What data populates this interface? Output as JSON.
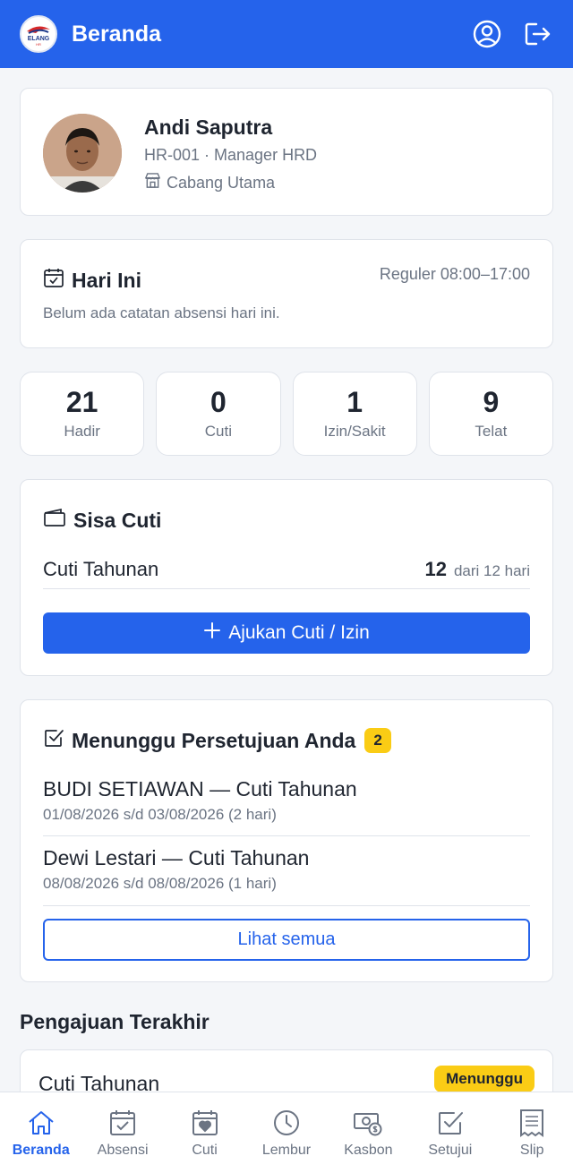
{
  "header": {
    "title": "Beranda",
    "logo_text": "ELANG",
    "logo_sub": "HR"
  },
  "profile": {
    "name": "Andi Saputra",
    "meta": "HR-001 · Manager HRD",
    "branch": "Cabang Utama"
  },
  "today": {
    "title": "Hari Ini",
    "shift": "Reguler 08:00–17:00",
    "note": "Belum ada catatan absensi hari ini."
  },
  "stats": [
    {
      "value": "21",
      "label": "Hadir"
    },
    {
      "value": "0",
      "label": "Cuti"
    },
    {
      "value": "1",
      "label": "Izin/Sakit"
    },
    {
      "value": "9",
      "label": "Telat"
    }
  ],
  "leave": {
    "title": "Sisa Cuti",
    "type": "Cuti Tahunan",
    "remaining": "12",
    "of": "dari 12 hari",
    "button": "Ajukan Cuti / Izin"
  },
  "approval": {
    "title": "Menunggu Persetujuan Anda",
    "count": "2",
    "items": [
      {
        "title": "BUDI SETIAWAN — Cuti Tahunan",
        "sub": "01/08/2026 s/d 03/08/2026 (2 hari)"
      },
      {
        "title": "Dewi Lestari — Cuti Tahunan",
        "sub": "08/08/2026 s/d 08/08/2026 (1 hari)"
      }
    ],
    "view_all": "Lihat semua"
  },
  "recent": {
    "section_title": "Pengajuan Terakhir",
    "type": "Cuti Tahunan",
    "status": "Menunggu"
  },
  "nav": [
    {
      "label": "Beranda",
      "icon": "home-icon",
      "active": true
    },
    {
      "label": "Absensi",
      "icon": "calendar-check-icon"
    },
    {
      "label": "Cuti",
      "icon": "calendar-heart-icon"
    },
    {
      "label": "Lembur",
      "icon": "clock-icon"
    },
    {
      "label": "Kasbon",
      "icon": "cash-icon"
    },
    {
      "label": "Setujui",
      "icon": "checkbox-icon"
    },
    {
      "label": "Slip",
      "icon": "receipt-icon"
    }
  ],
  "colors": {
    "primary": "#2563eb",
    "warning": "#facc15",
    "muted": "#6b7483"
  }
}
